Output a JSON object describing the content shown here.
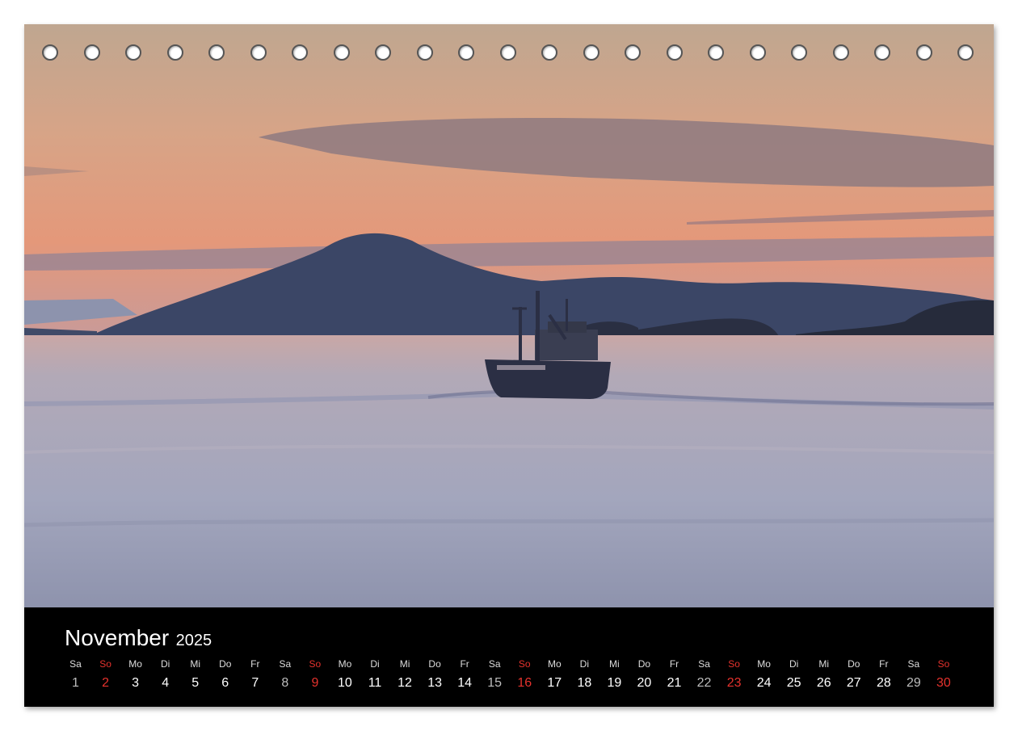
{
  "calendar": {
    "month": "November",
    "year": "2025",
    "days": [
      {
        "dow": "Sa",
        "num": "1",
        "type": "sat"
      },
      {
        "dow": "So",
        "num": "2",
        "type": "sun"
      },
      {
        "dow": "Mo",
        "num": "3",
        "type": "weekday"
      },
      {
        "dow": "Di",
        "num": "4",
        "type": "weekday"
      },
      {
        "dow": "Mi",
        "num": "5",
        "type": "weekday"
      },
      {
        "dow": "Do",
        "num": "6",
        "type": "weekday"
      },
      {
        "dow": "Fr",
        "num": "7",
        "type": "weekday"
      },
      {
        "dow": "Sa",
        "num": "8",
        "type": "sat"
      },
      {
        "dow": "So",
        "num": "9",
        "type": "sun"
      },
      {
        "dow": "Mo",
        "num": "10",
        "type": "weekday"
      },
      {
        "dow": "Di",
        "num": "11",
        "type": "weekday"
      },
      {
        "dow": "Mi",
        "num": "12",
        "type": "weekday"
      },
      {
        "dow": "Do",
        "num": "13",
        "type": "weekday"
      },
      {
        "dow": "Fr",
        "num": "14",
        "type": "weekday"
      },
      {
        "dow": "Sa",
        "num": "15",
        "type": "sat"
      },
      {
        "dow": "So",
        "num": "16",
        "type": "sun"
      },
      {
        "dow": "Mo",
        "num": "17",
        "type": "weekday"
      },
      {
        "dow": "Di",
        "num": "18",
        "type": "weekday"
      },
      {
        "dow": "Mi",
        "num": "19",
        "type": "weekday"
      },
      {
        "dow": "Do",
        "num": "20",
        "type": "weekday"
      },
      {
        "dow": "Fr",
        "num": "21",
        "type": "weekday"
      },
      {
        "dow": "Sa",
        "num": "22",
        "type": "sat"
      },
      {
        "dow": "So",
        "num": "23",
        "type": "sun"
      },
      {
        "dow": "Mo",
        "num": "24",
        "type": "weekday"
      },
      {
        "dow": "Di",
        "num": "25",
        "type": "weekday"
      },
      {
        "dow": "Mi",
        "num": "26",
        "type": "weekday"
      },
      {
        "dow": "Do",
        "num": "27",
        "type": "weekday"
      },
      {
        "dow": "Fr",
        "num": "28",
        "type": "weekday"
      },
      {
        "dow": "Sa",
        "num": "29",
        "type": "sat"
      },
      {
        "dow": "So",
        "num": "30",
        "type": "sun"
      }
    ]
  },
  "colors": {
    "sunday": "#e5322d",
    "saturday": "#bdbdbd",
    "footer_bg": "#000000",
    "sky_top": "#c9a98a",
    "sky_bottom": "#e89a78",
    "water": "#a7a9bd"
  },
  "photo": {
    "subject_icons": [
      "mountain-silhouette",
      "fishing-boat",
      "sunset-clouds"
    ]
  }
}
